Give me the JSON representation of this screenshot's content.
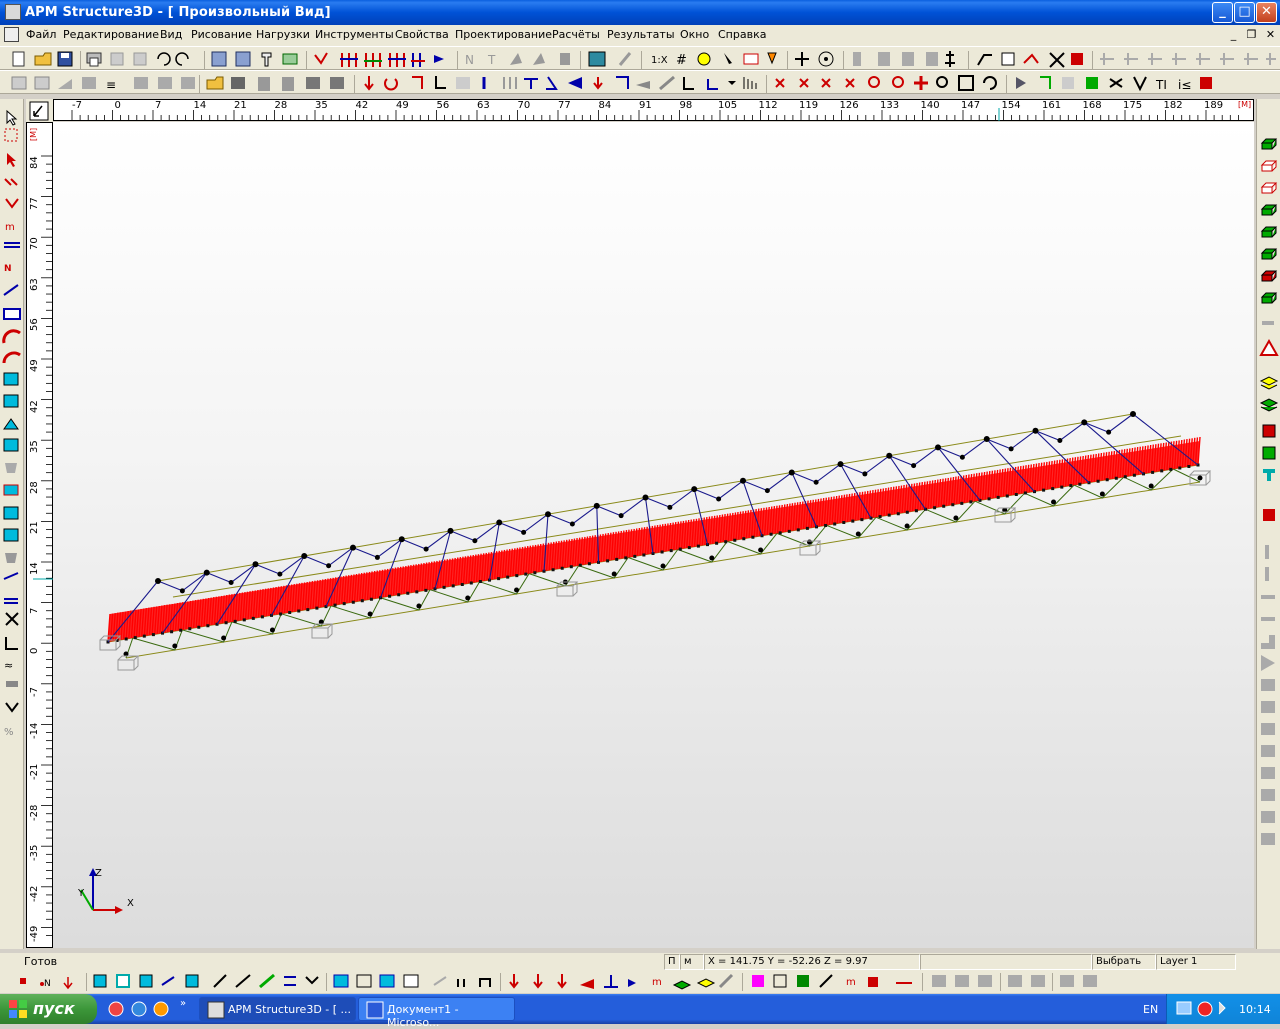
{
  "window": {
    "title": "APM Structure3D - [ Произвольный Вид]",
    "min_label": "_",
    "max_label": "□",
    "close_label": "✕"
  },
  "menu": {
    "items": [
      "Файл",
      "Редактирование",
      "Вид",
      "Рисование",
      "Нагрузки",
      "Инструменты",
      "Свойства",
      "Проектирование",
      "Расчёты",
      "Результаты",
      "Окно",
      "Справка"
    ],
    "mdi_min": "_",
    "mdi_restore": "❐",
    "mdi_close": "✕"
  },
  "rulers": {
    "unit": "[M]",
    "h_ticks": [
      "-7",
      "0",
      "7",
      "14",
      "21",
      "28",
      "35",
      "42",
      "49",
      "56",
      "63",
      "70",
      "77",
      "84",
      "91",
      "98",
      "105",
      "112",
      "119",
      "126",
      "133",
      "140",
      "147",
      "154",
      "161",
      "168",
      "175",
      "182",
      "189"
    ],
    "v_ticks": [
      "84",
      "77",
      "70",
      "63",
      "56",
      "49",
      "42",
      "35",
      "28",
      "21",
      "14",
      "7",
      "0",
      "-7",
      "-14",
      "-21",
      "-28",
      "-35",
      "-42",
      "-49"
    ]
  },
  "axes": {
    "z": "Z",
    "y": "Y",
    "x": "X"
  },
  "status": {
    "ready": "Готов",
    "p_label": "П",
    "m_label": "м",
    "coords": "X = 141.75 Y = -52.26 Z = 9.97",
    "mode": "Выбрать",
    "layer": "Layer 1"
  },
  "taskbar": {
    "start": "пуск",
    "items": [
      {
        "label": "APM Structure3D - [ ..."
      },
      {
        "label": "Документ1 - Microso..."
      }
    ],
    "lang": "EN",
    "time": "10:14"
  },
  "colors": {
    "load_red": "#ff0000",
    "truss_blue": "#1a1a8c",
    "chord_olive": "#8a8a1a",
    "node_black": "#000000"
  }
}
